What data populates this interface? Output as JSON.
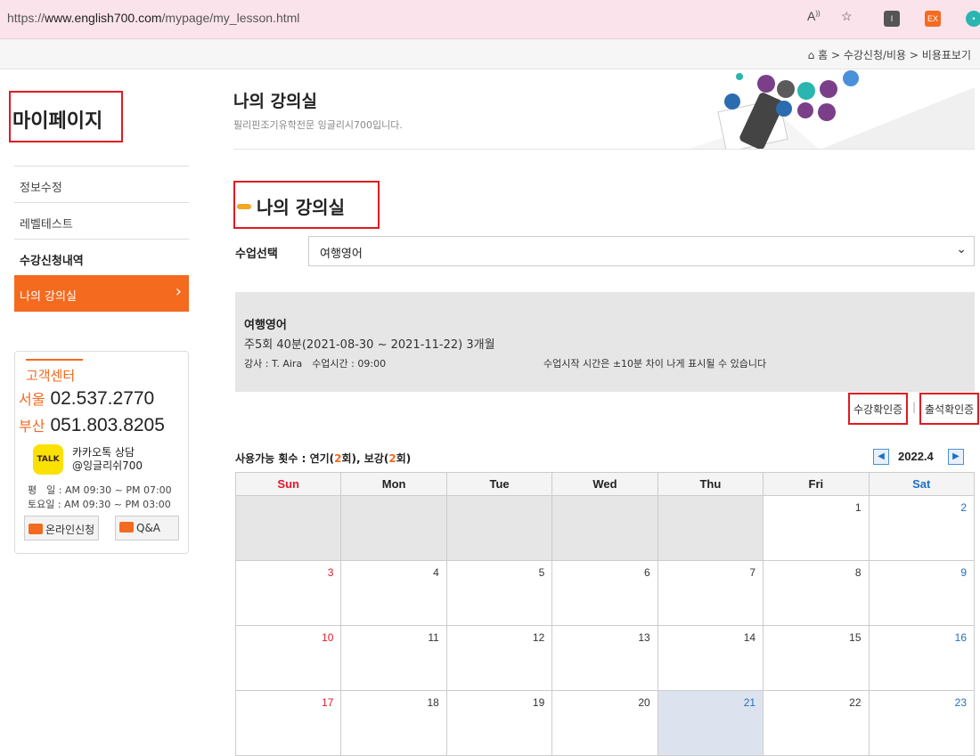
{
  "browser": {
    "url_prefix": "https://",
    "url_host": "www.english700.com",
    "url_path": "/mypage/my_lesson.html",
    "read_aloud": "A)",
    "ext_ex": "EX"
  },
  "breadcrumb": {
    "home_icon": "home-icon",
    "text": "홈 > 수강신청/비용 > 비용표보기"
  },
  "sidebar": {
    "title": "마이페이지",
    "items": [
      {
        "label": "정보수정"
      },
      {
        "label": "레벨테스트"
      },
      {
        "label": "수강신청내역"
      },
      {
        "label": "나의 강의실"
      }
    ]
  },
  "customer_center": {
    "title": "고객센터",
    "seoul_city": "서울",
    "seoul_phone": "02.537.2770",
    "busan_city": "부산",
    "busan_phone": "051.803.8205",
    "kakao_badge": "TALK",
    "kakao_line1": "카카오톡 상담",
    "kakao_line2": "@잉글리쉬700",
    "hours_weekday": "평　일 : AM 09:30 ~ PM 07:00",
    "hours_saturday": "토요일 : AM 09:30 ~ PM 03:00",
    "online_button": "온라인신청",
    "qa_button": "Q&A"
  },
  "header": {
    "title": "나의 강의실",
    "subtitle": "필리핀조기유학전문 잉글리시700입니다."
  },
  "section": {
    "title": "나의 강의실"
  },
  "class_select": {
    "label": "수업선택",
    "value": "여행영어"
  },
  "class_info": {
    "name": "여행영어",
    "period": "주5회 40분(2021-08-30 ~ 2021-11-22) 3개월",
    "teacher": "강사 : T. Aira　수업시간 : 09:00",
    "notice": "수업시작 시간은 ±10분 차이 나게 표시될 수 있습니다"
  },
  "certs": {
    "attend_course": "수강확인증",
    "separator": "|",
    "attendance": "출석확인증"
  },
  "availability": {
    "prefix": "사용가능 횟수 : 연기(",
    "postpone_count": "2",
    "middle": "회), 보강(",
    "makeup_count": "2",
    "suffix": "회)"
  },
  "calendar": {
    "month": "2022.4",
    "weekdays": [
      "Sun",
      "Mon",
      "Tue",
      "Wed",
      "Thu",
      "Fri",
      "Sat"
    ],
    "weeks": [
      [
        "",
        "",
        "",
        "",
        "",
        "1",
        "2"
      ],
      [
        "3",
        "4",
        "5",
        "6",
        "7",
        "8",
        "9"
      ],
      [
        "10",
        "11",
        "12",
        "13",
        "14",
        "15",
        "16"
      ],
      [
        "17",
        "18",
        "19",
        "20",
        "21",
        "22",
        "23"
      ]
    ],
    "today": "21"
  },
  "colors": {
    "accent": "#f46a1f",
    "highlight_border": "#e01a22",
    "sunday": "#e0182d",
    "saturday": "#1f6fc5"
  }
}
